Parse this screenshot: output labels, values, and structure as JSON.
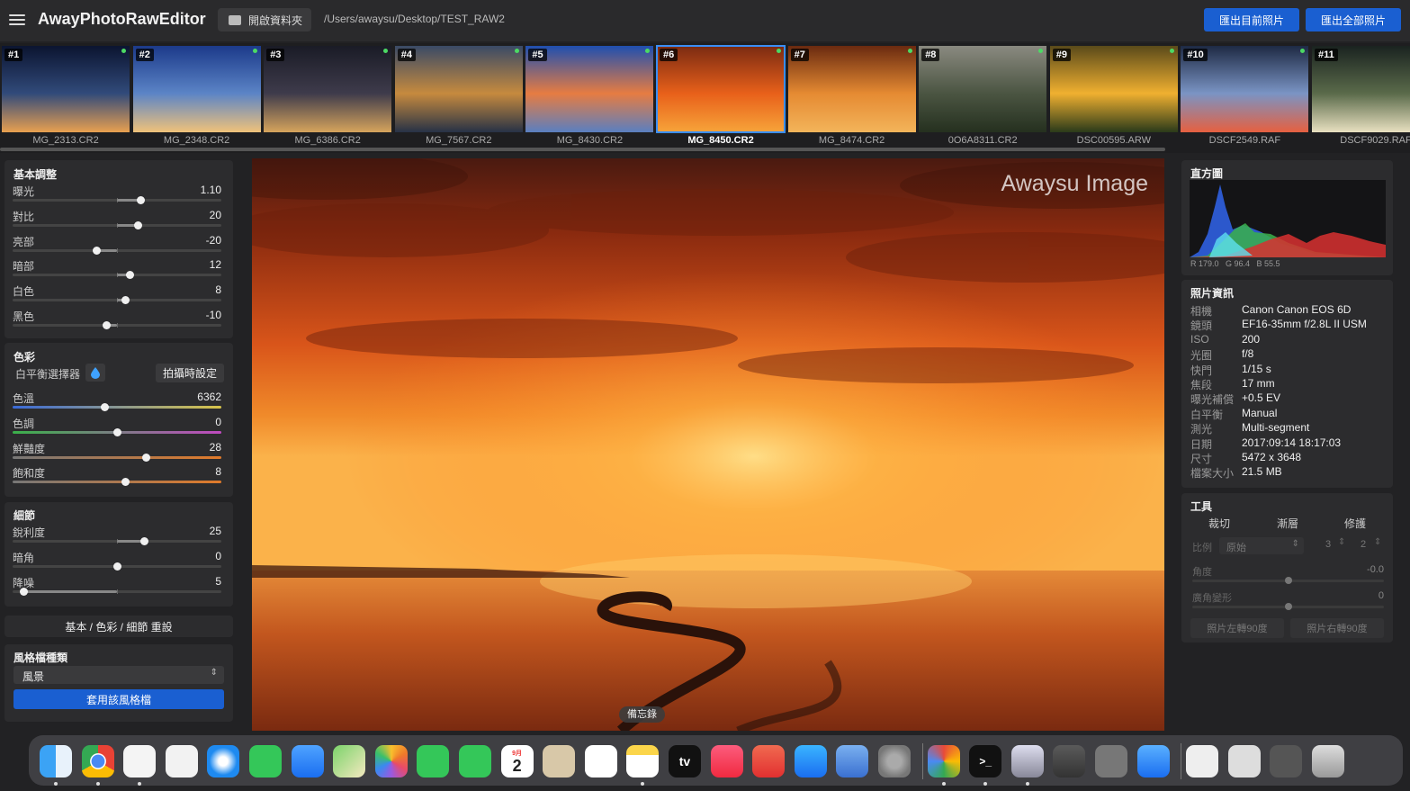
{
  "app": {
    "title": "AwayPhotoRawEditor"
  },
  "toolbar": {
    "open_folder": "開啟資料夾",
    "path": "/Users/awaysu/Desktop/TEST_RAW2",
    "export_current": "匯出目前照片",
    "export_all": "匯出全部照片"
  },
  "filmstrip": [
    {
      "num": "#1",
      "name": "MG_2313.CR2",
      "colors": [
        "#0b1430",
        "#314a7a",
        "#e8a050"
      ]
    },
    {
      "num": "#2",
      "name": "MG_2348.CR2",
      "colors": [
        "#1c3a8a",
        "#5b84c6",
        "#f0c27a"
      ]
    },
    {
      "num": "#3",
      "name": "MG_6386.CR2",
      "colors": [
        "#1a1b26",
        "#3e3b4b",
        "#d6a45c"
      ]
    },
    {
      "num": "#4",
      "name": "MG_7567.CR2",
      "colors": [
        "#3a4a66",
        "#c68a3e",
        "#273246"
      ]
    },
    {
      "num": "#5",
      "name": "MG_8430.CR2",
      "colors": [
        "#1f4fb0",
        "#e67c42",
        "#5a7fc0"
      ]
    },
    {
      "num": "#6",
      "name": "MG_8450.CR2",
      "colors": [
        "#7a2a12",
        "#e8601a",
        "#f7a43a"
      ]
    },
    {
      "num": "#7",
      "name": "MG_8474.CR2",
      "colors": [
        "#6a2a10",
        "#e58a32",
        "#f3b45a"
      ]
    },
    {
      "num": "#8",
      "name": "0O6A8311.CR2",
      "colors": [
        "#8a8a80",
        "#4b5542",
        "#25301f"
      ]
    },
    {
      "num": "#9",
      "name": "DSC00595.ARW",
      "colors": [
        "#5a4a1a",
        "#f0b030",
        "#2a3a1a"
      ]
    },
    {
      "num": "#10",
      "name": "DSCF2549.RAF",
      "colors": [
        "#1e2a44",
        "#7a94c4",
        "#e66040"
      ]
    },
    {
      "num": "#11",
      "name": "DSCF9029.RAF",
      "colors": [
        "#1a2320",
        "#5a6a4a",
        "#e8e0c0"
      ]
    }
  ],
  "basic": {
    "title": "基本調整",
    "sliders": [
      {
        "label": "曝光",
        "value": "1.10",
        "pos": 0.61
      },
      {
        "label": "對比",
        "value": "20",
        "pos": 0.6
      },
      {
        "label": "亮部",
        "value": "-20",
        "pos": 0.4
      },
      {
        "label": "暗部",
        "value": "12",
        "pos": 0.56
      },
      {
        "label": "白色",
        "value": "8",
        "pos": 0.54
      },
      {
        "label": "黑色",
        "value": "-10",
        "pos": 0.45
      }
    ]
  },
  "color": {
    "title": "色彩",
    "wb_picker": "白平衡選擇器",
    "as_shot": "拍攝時設定",
    "sliders": [
      {
        "label": "色溫",
        "value": "6362",
        "pos": 0.44,
        "type": "temp"
      },
      {
        "label": "色調",
        "value": "0",
        "pos": 0.5,
        "type": "tint"
      },
      {
        "label": "鮮豔度",
        "value": "28",
        "pos": 0.64,
        "type": "sat"
      },
      {
        "label": "飽和度",
        "value": "8",
        "pos": 0.54,
        "type": "sat"
      }
    ]
  },
  "detail": {
    "title": "細節",
    "sliders": [
      {
        "label": "銳利度",
        "value": "25",
        "pos": 0.63
      },
      {
        "label": "暗角",
        "value": "0",
        "pos": 0.5
      },
      {
        "label": "降噪",
        "value": "5",
        "pos": 0.05
      }
    ]
  },
  "reset_button": "基本 / 色彩 / 細節 重設",
  "style": {
    "title": "風格檔種類",
    "selected": "風景",
    "apply": "套用該風格檔"
  },
  "photo": {
    "watermark": "Awaysu Image",
    "tooltip": "備忘錄"
  },
  "histogram": {
    "title": "直方圖",
    "readout": "R 179.0   G 96.4   B 55.5"
  },
  "info": {
    "title": "照片資訊",
    "rows": [
      {
        "k": "相機",
        "v": "Canon Canon EOS 6D"
      },
      {
        "k": "鏡頭",
        "v": "EF16-35mm f/2.8L II USM"
      },
      {
        "k": "ISO",
        "v": "200"
      },
      {
        "k": "光圈",
        "v": "f/8"
      },
      {
        "k": "快門",
        "v": "1/15 s"
      },
      {
        "k": "焦段",
        "v": "17 mm"
      },
      {
        "k": "曝光補償",
        "v": "+0.5 EV"
      },
      {
        "k": "白平衡",
        "v": "Manual"
      },
      {
        "k": "測光",
        "v": "Multi-segment"
      },
      {
        "k": "日期",
        "v": "2017:09:14 18:17:03"
      },
      {
        "k": "尺寸",
        "v": "5472 x 3648"
      },
      {
        "k": "檔案大小",
        "v": "21.5 MB"
      }
    ]
  },
  "tools": {
    "title": "工具",
    "tabs": [
      "裁切",
      "漸層",
      "修護"
    ],
    "ratio_label": "比例",
    "ratio_value": "原始",
    "ratio_w": "3",
    "ratio_h": "2",
    "angle_label": "角度",
    "angle_value": "-0.0",
    "distort_label": "廣角變形",
    "distort_value": "0",
    "rotate_left": "照片左轉90度",
    "rotate_right": "照片右轉90度"
  },
  "dock": {
    "calendar_month": "9月",
    "calendar_day": "2",
    "apps": [
      "finder-icon",
      "chrome-icon",
      "launchpad-icon",
      "calendar-grid-icon",
      "safari-icon",
      "messages-icon",
      "mail-icon",
      "maps-icon",
      "photos-icon",
      "facetime-icon",
      "phone-icon",
      "calendar-icon",
      "contacts-icon",
      "reminders-icon",
      "notes-icon",
      "tv-icon",
      "music-icon",
      "rocket-icon",
      "appstore-icon",
      "preview-icon",
      "settings-icon",
      "photos-color-icon",
      "terminal-icon",
      "disk-icon",
      "keychain-icon",
      "automator-icon",
      "safari-blue-icon",
      "certificate-icon",
      "document-icon",
      "folder-icon",
      "trash-icon"
    ],
    "tv_label": "tv"
  },
  "colors": {
    "accent": "#1a5fd1",
    "selected_outline": "#3a8ef6"
  }
}
